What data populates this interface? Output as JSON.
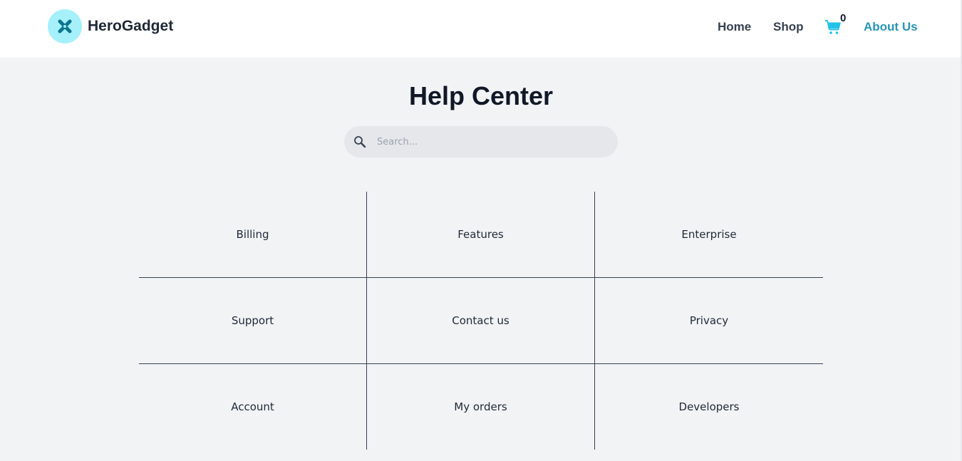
{
  "brand": {
    "name": "HeroGadget",
    "logo_icon": "x-icon",
    "logo_bg": "#a5f0fb",
    "logo_fg": "#0e7490"
  },
  "nav": {
    "home": "Home",
    "shop": "Shop",
    "cart_icon": "shopping-cart-icon",
    "cart_count": "0",
    "about": "About Us",
    "active_color": "#2795b8",
    "cart_color": "#22c3e6"
  },
  "main": {
    "title": "Help Center",
    "search": {
      "placeholder": "Search...",
      "icon": "search-icon"
    },
    "topics": [
      "Billing",
      "Features",
      "Enterprise",
      "Support",
      "Contact us",
      "Privacy",
      "Account",
      "My orders",
      "Developers"
    ]
  }
}
